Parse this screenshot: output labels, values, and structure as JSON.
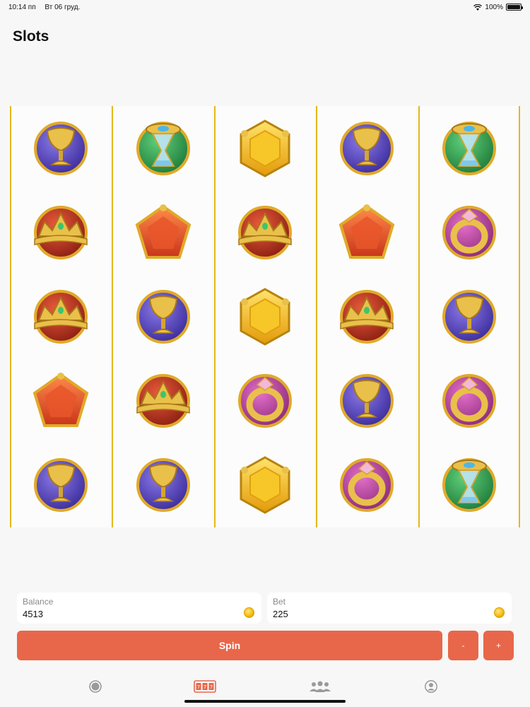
{
  "status_bar": {
    "time": "10:14 пп",
    "date": "Вт 06 груд.",
    "battery": "100%"
  },
  "page": {
    "title": "Slots"
  },
  "reels": [
    [
      "chalice",
      "crown",
      "crown",
      "pentagon",
      "chalice"
    ],
    [
      "hourglass",
      "pentagon",
      "chalice",
      "crown",
      "chalice"
    ],
    [
      "hexagon",
      "crown",
      "hexagon",
      "ring",
      "hexagon"
    ],
    [
      "chalice",
      "pentagon",
      "crown",
      "chalice",
      "ring"
    ],
    [
      "hourglass",
      "ring",
      "chalice",
      "ring",
      "hourglass"
    ]
  ],
  "balance": {
    "label": "Balance",
    "value": "4513"
  },
  "bet": {
    "label": "Bet",
    "value": "225"
  },
  "controls": {
    "spin_label": "Spin",
    "decrease_label": "-",
    "increase_label": "+"
  },
  "tabs": [
    {
      "icon": "circle-icon",
      "active": false
    },
    {
      "icon": "slot-machine-icon",
      "active": true
    },
    {
      "icon": "group-icon",
      "active": false
    },
    {
      "icon": "profile-icon",
      "active": false
    }
  ],
  "colors": {
    "accent": "#e8674a",
    "reel_divider": "#e4b81c",
    "gold": "#e0aa2a"
  }
}
